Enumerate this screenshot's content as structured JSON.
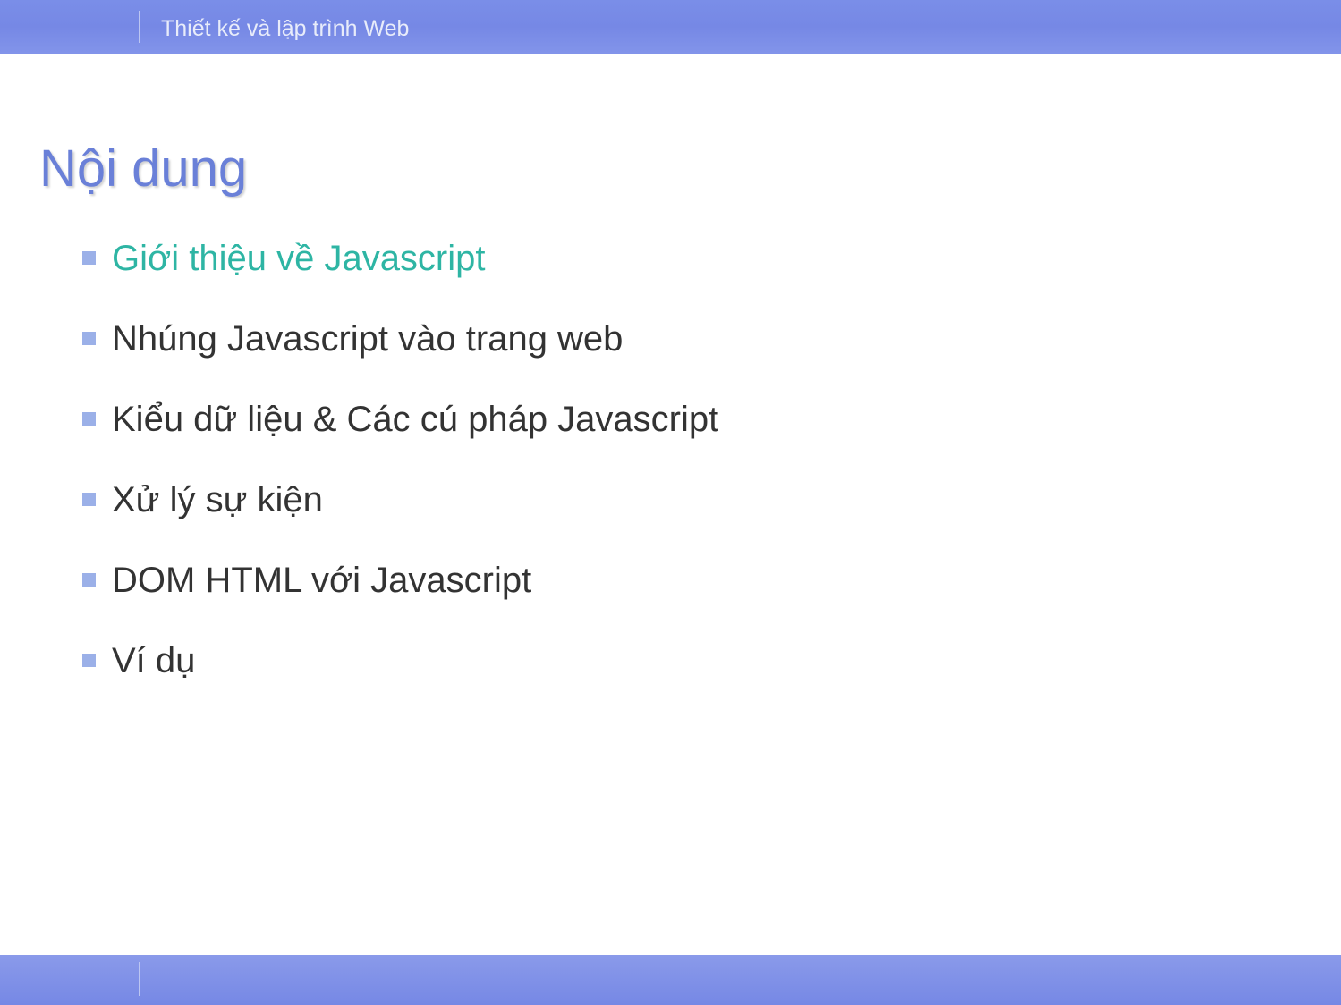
{
  "header": {
    "breadcrumb": "Thiết kế và lập trình Web"
  },
  "slide": {
    "title": "Nội dung",
    "bullets": [
      {
        "text": "Giới thiệu về Javascript",
        "highlight": true
      },
      {
        "text": "Nhúng Javascript vào trang web",
        "highlight": false
      },
      {
        "text": "Kiểu dữ liệu & Các cú pháp Javascript",
        "highlight": false
      },
      {
        "text": "Xử lý sự kiện",
        "highlight": false
      },
      {
        "text": "DOM HTML với Javascript",
        "highlight": false
      },
      {
        "text": "Ví dụ",
        "highlight": false
      }
    ]
  },
  "colors": {
    "header_bg": "#7688e5",
    "title_color": "#6a80d8",
    "highlight_color": "#2eb5a4",
    "bullet_marker": "#9bb0e8",
    "body_text": "#333333"
  }
}
